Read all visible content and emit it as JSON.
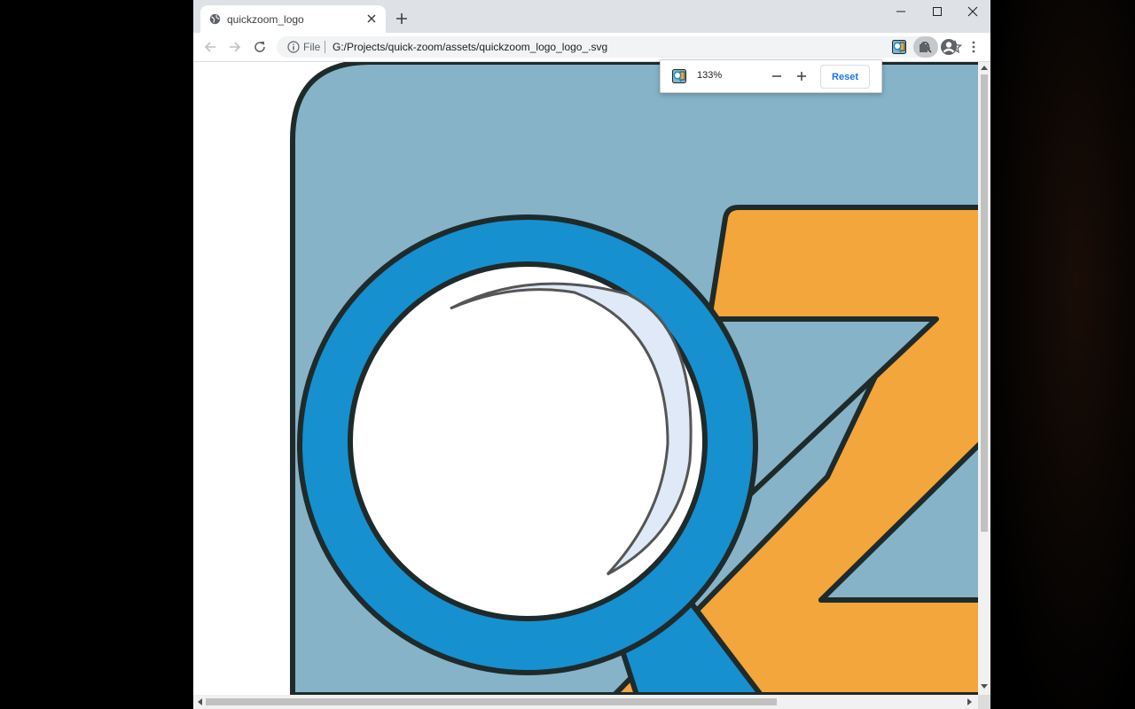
{
  "browser": {
    "tab": {
      "title": "quickzoom_logo",
      "icon": "globe-icon"
    },
    "window_controls": [
      "minimize-icon",
      "maximize-icon",
      "close-icon"
    ],
    "toolbar": {
      "back_icon": "arrow-left-icon",
      "forward_icon": "arrow-right-icon",
      "reload_icon": "reload-icon",
      "scheme_label": "File",
      "url": "G:/Projects/quick-zoom/assets/quickzoom_logo_logo_.svg",
      "zoom_icon": "zoom-in-icon",
      "bookmark_icon": "star-icon",
      "extension_icons": [
        "quickzoom-extension-icon",
        "puzzle-icon",
        "account-icon",
        "more-vert-icon"
      ]
    }
  },
  "zoom_popup": {
    "level": "133%",
    "minus_icon": "minus-icon",
    "plus_icon": "plus-icon",
    "reset_label": "Reset"
  },
  "colors": {
    "logo_background": "#86b3c7",
    "lens_ring": "#1690cf",
    "letter_z": "#f2a63b",
    "outline": "#1f2a2a",
    "lens_highlight": "#dfe9f7",
    "tab_strip": "#dee1e6"
  }
}
